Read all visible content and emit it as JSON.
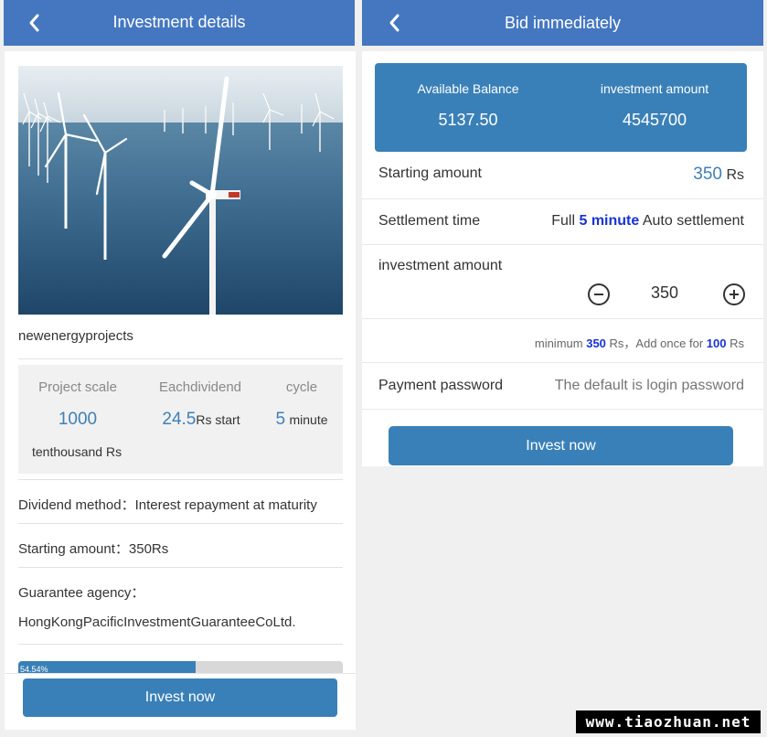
{
  "left": {
    "title": "Investment details",
    "project_name": "newenergyprojects",
    "stats": {
      "scale_label": "Project scale",
      "scale_value": "1000",
      "scale_unit": "tenthousand Rs",
      "dividend_label": "Eachdividend",
      "dividend_value": "24.5",
      "dividend_unit": "Rs start",
      "cycle_label": "cycle",
      "cycle_value": "5",
      "cycle_unit": "minute"
    },
    "dividend_method": "Dividend method：Interest repayment at maturity",
    "starting_amount": "Starting amount：350Rs",
    "guarantee_label": "Guarantee agency：",
    "guarantee_value": "HongKongPacificInvestmentGuaranteeCoLtd.",
    "progress_percent": 54.54,
    "progress_text": "54.54%",
    "invest_button": "Invest now"
  },
  "right": {
    "title": "Bid immediately",
    "available_balance_label": "Available Balance",
    "available_balance_value": "5137.50",
    "investment_amount_label": "investment amount",
    "investment_amount_value": "4545700",
    "starting_amount_label": "Starting amount",
    "starting_amount_value": "350",
    "starting_amount_unit": "Rs",
    "settlement_label": "Settlement time",
    "settlement_prefix": "Full",
    "settlement_value": "5 minute",
    "settlement_suffix": "Auto settlement",
    "investment_label": "investment amount",
    "stepper_value": "350",
    "note_prefix": "minimum",
    "note_min": "350",
    "note_mid": "Rs，Add once for",
    "note_step": "100",
    "note_suffix": "Rs",
    "password_label": "Payment password",
    "password_placeholder": "The default is login password",
    "invest_button": "Invest now"
  },
  "watermark": "www.tiaozhuan.net",
  "colors": {
    "nav": "#4477c0",
    "accent": "#3a80b8",
    "highlight": "#1733d4"
  },
  "icons": {
    "back": "chevron-left-icon",
    "minus": "minus-circle-icon",
    "plus": "plus-circle-icon"
  }
}
